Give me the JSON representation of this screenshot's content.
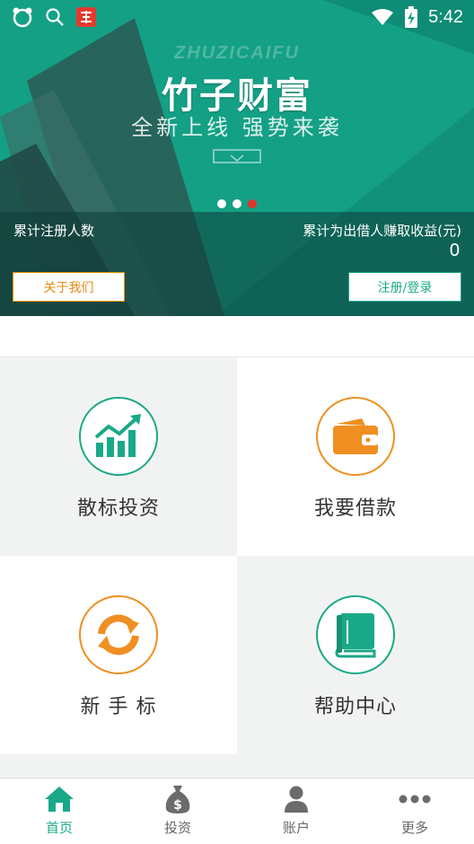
{
  "status_bar": {
    "time": "5:42"
  },
  "banner": {
    "brand_en": "ZHUZICAIFU",
    "brand_cn": "竹子财富",
    "slogan": "全新上线  强势来袭",
    "pager": {
      "count": 3,
      "active": 2
    },
    "stats": {
      "registered_label": "累计注册人数",
      "earnings_label": "累计为出借人赚取收益(元)",
      "earnings_value": "0"
    },
    "about_button": "关于我们",
    "login_button": "注册/登录"
  },
  "menu": {
    "items": [
      {
        "label": "散标投资",
        "icon": "growth-chart-icon",
        "color": "#1aa988"
      },
      {
        "label": "我要借款",
        "icon": "wallet-icon",
        "color": "#ef8f21"
      },
      {
        "label": "新 手 标",
        "icon": "refresh-arrows-icon",
        "color": "#ef8f21"
      },
      {
        "label": "帮助中心",
        "icon": "book-icon",
        "color": "#1aa988"
      }
    ]
  },
  "tabbar": {
    "tabs": [
      {
        "label": "首页",
        "icon": "home-icon",
        "active": true
      },
      {
        "label": "投资",
        "icon": "money-bag-icon",
        "active": false
      },
      {
        "label": "账户",
        "icon": "user-icon",
        "active": false
      },
      {
        "label": "更多",
        "icon": "more-dots-icon",
        "active": false
      }
    ]
  },
  "colors": {
    "primary": "#1aa988",
    "accent": "#ef8f21",
    "pager_active": "#e2332e"
  }
}
